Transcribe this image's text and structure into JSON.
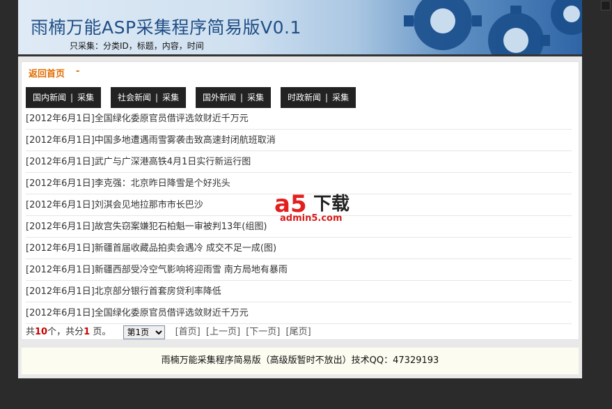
{
  "header": {
    "title": "雨楠万能ASP采集程序简易版V0.1",
    "subtitle": "只采集：分类ID，标题，内容，时间"
  },
  "nav": {
    "home_label": "返回首页",
    "home_dash": "-"
  },
  "tabs": [
    {
      "category": "国内新闻",
      "sep": "|",
      "action": "采集"
    },
    {
      "category": "社会新闻",
      "sep": "|",
      "action": "采集"
    },
    {
      "category": "国外新闻",
      "sep": "|",
      "action": "采集"
    },
    {
      "category": "时政新闻",
      "sep": "|",
      "action": "采集"
    }
  ],
  "news": [
    "[2012年6月1日]全国绿化委原官员借评选敛财近千万元",
    "[2012年6月1日]中国多地遭遇雨雪雾袭击致高速封闭航班取消",
    "[2012年6月1日]武广与广深港高铁4月1日实行新运行图",
    "[2012年6月1日]李克强：北京昨日降雪是个好兆头",
    "[2012年6月1日]刘淇会见地拉那市市长巴沙",
    "[2012年6月1日]故宫失窃案嫌犯石柏魁一审被判13年(组图)",
    "[2012年6月1日]新疆首届收藏品拍卖会遇冷 成交不足一成(图)",
    "[2012年6月1日]新疆西部受冷空气影响将迎雨雪 南方局地有暴雨",
    "[2012年6月1日]北京部分银行首套房贷利率降低",
    "[2012年6月1日]全国绿化委原官员借评选敛财近千万元"
  ],
  "pager": {
    "prefix": "共",
    "total": "10",
    "mid": "个，共分",
    "pages": "1",
    "suffix": "页。",
    "selected_page": "第1页",
    "first": "[首页]",
    "prev": "[上一页]",
    "next": "[下一页]",
    "last": "[尾页]"
  },
  "footer": {
    "text": "雨楠万能采集程序简易版（高级版暂时不放出）技术QQ：47329193"
  },
  "watermark": {
    "brand": "a5",
    "label": "下载",
    "url": "admin5.com"
  },
  "colors": {
    "accent": "#e06c00",
    "tab_bg": "#222222",
    "count_red": "#cc0000",
    "footer_bg": "#fcfcf0"
  }
}
